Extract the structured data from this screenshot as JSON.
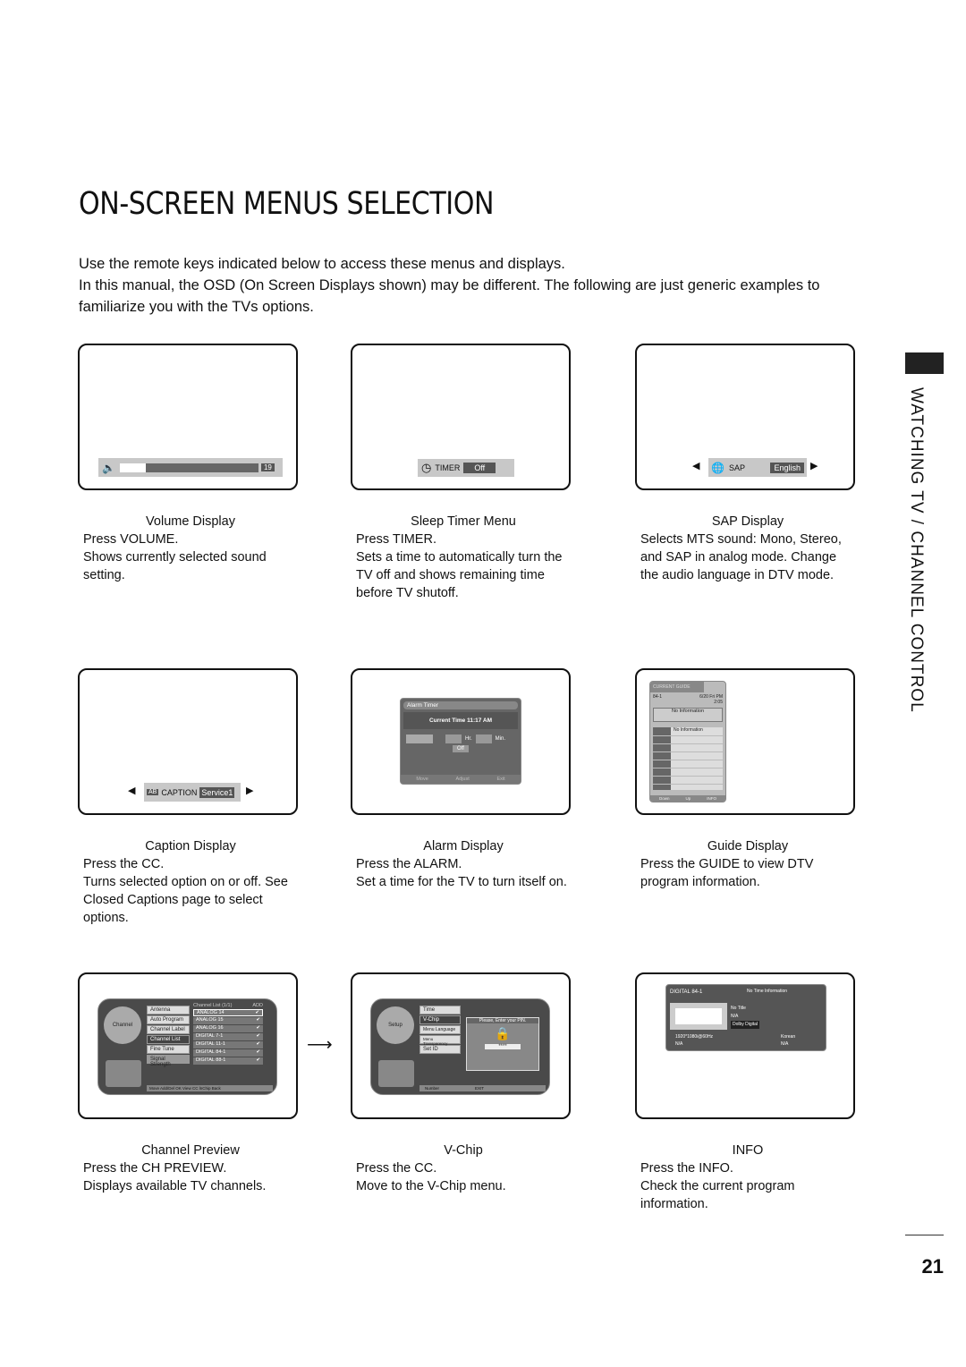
{
  "title": "ON-SCREEN MENUS SELECTION",
  "intro": [
    "Use the remote keys indicated below to access these menus and displays.",
    "In this manual, the OSD (On Screen Displays shown) may be different. The following are just generic examples to familiarize you with the TVs options."
  ],
  "side_label": "WATCHING TV / CHANNEL CONTROL",
  "page_number": "21",
  "panels": [
    {
      "title": "Volume Display",
      "lines": [
        "Press VOLUME.",
        "Shows currently selected sound setting."
      ],
      "osd": {
        "value": "19",
        "level": 0.19
      }
    },
    {
      "title": "Sleep Timer Menu",
      "lines": [
        "Press TIMER.",
        "Sets a time to automatically turn the TV off and shows remaining time before TV shutoff."
      ],
      "osd": {
        "label": "TIMER",
        "value": "Off"
      }
    },
    {
      "title": "SAP Display",
      "lines": [
        "Selects MTS sound: Mono, Stereo, and SAP in analog mode. Change the audio language in DTV mode."
      ],
      "osd": {
        "label": "SAP",
        "value": "English"
      }
    },
    {
      "title": "Caption Display",
      "lines": [
        "Press the CC.",
        "Turns selected option on or off. See Closed Captions page to select options."
      ],
      "osd": {
        "label": "CAPTION",
        "value": "Service1"
      }
    },
    {
      "title": "Alarm Display",
      "lines": [
        "Press the ALARM.",
        "Set a time for the TV to turn itself on."
      ],
      "osd": {
        "header": "Alarm Timer",
        "time": "Current Time 11:17 AM",
        "hr": "Hr.",
        "min": "Min.",
        "off": "Off",
        "move": "Move",
        "adjust": "Adjust",
        "exit": "Exit"
      }
    },
    {
      "title": "Guide Display",
      "lines": [
        "Press the GUIDE to view DTV program information."
      ],
      "osd": {
        "header": "CURRENT GUIDE",
        "channel": "84-1",
        "time": "6/20 Fri PM 2:05",
        "info": "No Information",
        "list_info": "No Information",
        "down": "Down",
        "up": "Up",
        "info_btn": "INFO"
      }
    },
    {
      "title": "Channel Preview",
      "lines": [
        "Press the CH PREVIEW.",
        "Displays available TV channels."
      ],
      "osd": {
        "menu": [
          "Antenna",
          "Auto Program",
          "Channel Label",
          "Channel List",
          "Fine Tune",
          "Signal Strength"
        ],
        "list_title": "Channel List (1/1)",
        "add": "ADD",
        "channels": [
          "ANALOG 14",
          "ANALOG 15",
          "ANALOG 16",
          "DIGITAL 7-1",
          "DIGITAL 11-1",
          "DIGITAL 84-1",
          "DIGITAL 88-1"
        ],
        "footer": "Move  Add/Del  OK View  CC lnChip  Back",
        "icon_label": "Channel"
      }
    },
    {
      "title": "V-Chip",
      "lines": [
        "Press the CC.",
        "Move to the V-Chip menu."
      ],
      "osd": {
        "menu": [
          "Time",
          "V-Chip",
          "Menu Language",
          "Menu Transparency",
          "Set ID"
        ],
        "prompt": "Please, Enter your PIN.",
        "pin": "****",
        "footer_num": "Number",
        "footer_exit": "EXIT",
        "icon_label": "Setup"
      }
    },
    {
      "title": "INFO",
      "lines": [
        "Press the INFO.",
        "Check the current program information."
      ],
      "osd": {
        "channel": "DIGITAL 84-1",
        "time": "No Time Information",
        "title": "No Title",
        "na": "N/A",
        "audio": "Dolby Digital",
        "res": "1920*1080i@60Hz",
        "lang": "Korean",
        "cap": "N/A",
        "cc": "N/A"
      }
    }
  ]
}
